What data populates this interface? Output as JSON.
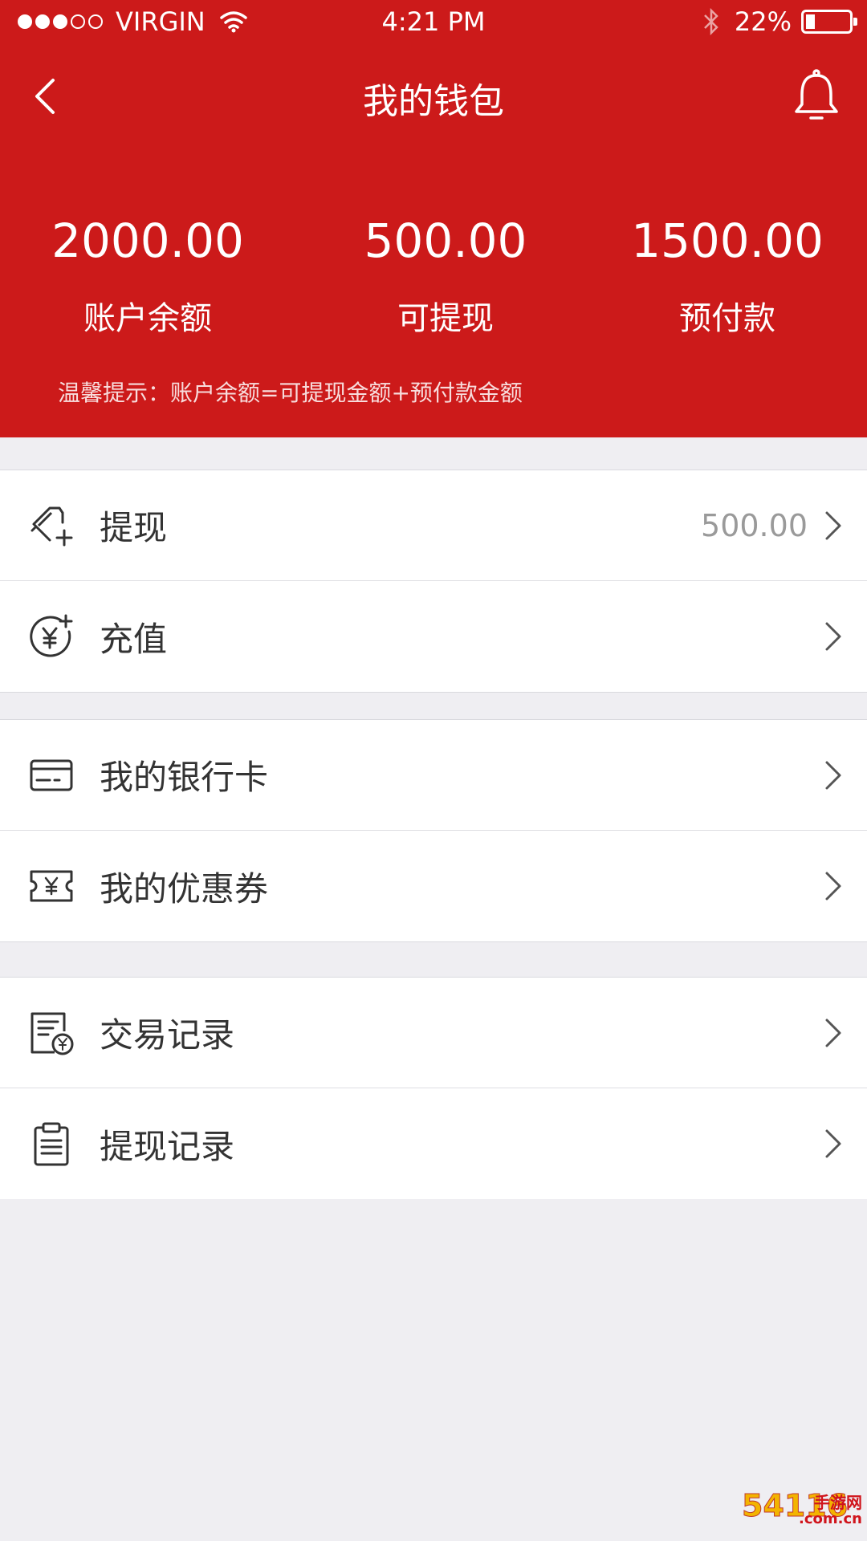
{
  "status_bar": {
    "carrier": "VIRGIN",
    "time": "4:21 PM",
    "battery": "22%",
    "battery_level": 0.22,
    "signal_bars_filled": 3,
    "signal_bars_total": 5
  },
  "nav": {
    "title": "我的钱包",
    "back_icon": "chevron-left-icon",
    "bell_icon": "bell-icon"
  },
  "balances": [
    {
      "amount": "2000.00",
      "label": "账户余额"
    },
    {
      "amount": "500.00",
      "label": "可提现"
    },
    {
      "amount": "1500.00",
      "label": "预付款"
    }
  ],
  "tip": "温馨提示：账户余额=可提现金额+预付款金额",
  "menu": {
    "withdraw": {
      "label": "提现",
      "value": "500.00",
      "icon": "withdraw-card-icon"
    },
    "recharge": {
      "label": "充值",
      "icon": "yuan-plus-icon"
    },
    "bank_card": {
      "label": "我的银行卡",
      "icon": "bank-card-icon"
    },
    "coupon": {
      "label": "我的优惠券",
      "icon": "coupon-icon"
    },
    "transactions": {
      "label": "交易记录",
      "icon": "transaction-record-icon"
    },
    "withdraw_records": {
      "label": "提现记录",
      "icon": "clipboard-icon"
    }
  },
  "watermark": {
    "brand": "54116",
    "text": "手游网",
    "domain": ".com.cn"
  },
  "colors": {
    "header_red": "#cc1a1a",
    "page_bg": "#efeef2",
    "row_bg": "#ffffff",
    "secondary_text": "#9a9a9a"
  }
}
